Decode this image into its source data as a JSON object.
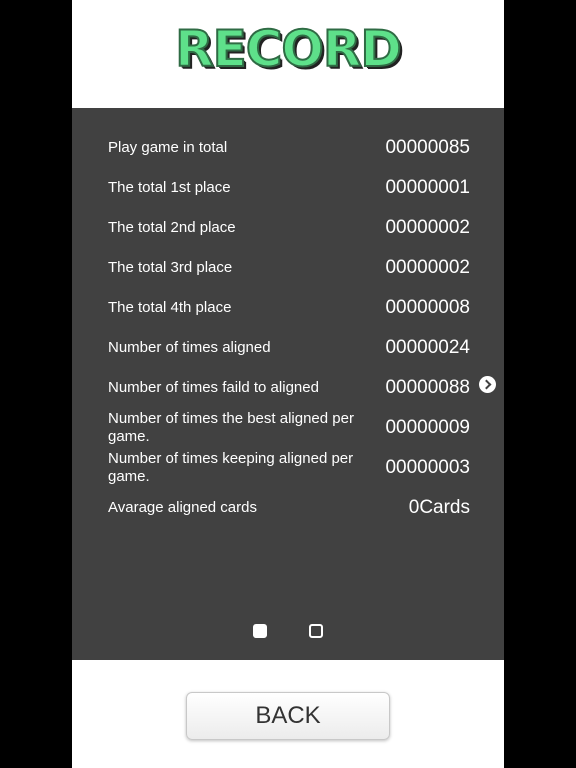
{
  "header": {
    "title": "RECORD"
  },
  "stats": [
    {
      "label": "Play game in total",
      "value": "00000085"
    },
    {
      "label": "The total 1st place",
      "value": "00000001"
    },
    {
      "label": "The total 2nd place",
      "value": "00000002"
    },
    {
      "label": "The total 3rd place",
      "value": "00000002"
    },
    {
      "label": "The total 4th place",
      "value": "00000008"
    },
    {
      "label": "Number of times aligned",
      "value": "00000024"
    },
    {
      "label": "Number of times faild to aligned",
      "value": "00000088"
    },
    {
      "label": "Number of times the best aligned per game.",
      "value": "00000009"
    },
    {
      "label": "Number of times keeping aligned per game.",
      "value": "00000003"
    },
    {
      "label": "Avarage aligned cards",
      "value": "0Cards"
    }
  ],
  "pager": {
    "page_count": 2,
    "current_page": 1,
    "next_icon": "chevron-right-circle"
  },
  "footer": {
    "back_label": "BACK"
  },
  "colors": {
    "title_fill": "#5ee08a",
    "panel": "#414141",
    "background": "#000000"
  }
}
